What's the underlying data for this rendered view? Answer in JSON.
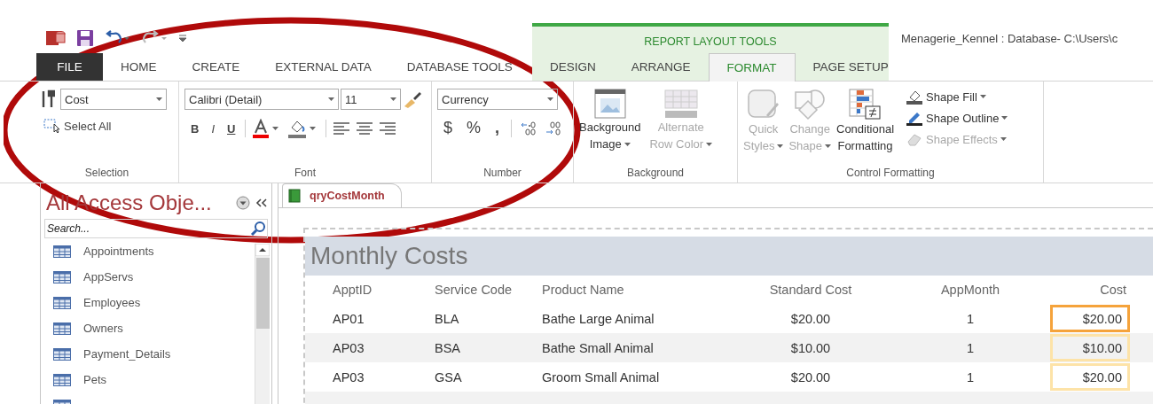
{
  "quick_access": {
    "undo_enabled": true,
    "redo_enabled": false
  },
  "context_label": "REPORT LAYOUT TOOLS",
  "window_title": "Menagerie_Kennel : Database- C:\\Users\\c",
  "tabs": [
    {
      "label": "FILE",
      "kind": "file",
      "selected": false
    },
    {
      "label": "HOME",
      "kind": "main",
      "selected": false
    },
    {
      "label": "CREATE",
      "kind": "main",
      "selected": false
    },
    {
      "label": "EXTERNAL DATA",
      "kind": "main",
      "selected": false
    },
    {
      "label": "DATABASE TOOLS",
      "kind": "main",
      "selected": false
    },
    {
      "label": "DESIGN",
      "kind": "context",
      "selected": false
    },
    {
      "label": "ARRANGE",
      "kind": "context",
      "selected": false
    },
    {
      "label": "FORMAT",
      "kind": "context",
      "selected": true
    },
    {
      "label": "PAGE SETUP",
      "kind": "context",
      "selected": false
    }
  ],
  "ribbon": {
    "selection": {
      "label": "Selection",
      "object": "Cost",
      "select_all": "Select All"
    },
    "font": {
      "label": "Font",
      "name": "Calibri (Detail)",
      "size": "11",
      "bold": "B",
      "italic": "I",
      "underline": "U"
    },
    "number": {
      "label": "Number",
      "format": "Currency",
      "currency": "$",
      "percent": "%",
      "comma": ","
    },
    "background": {
      "label": "Background",
      "buttons": [
        {
          "line1": "Background",
          "line2": "Image",
          "kind": "image",
          "disabled": false
        },
        {
          "line1": "Alternate",
          "line2": "Row Color",
          "kind": "rows",
          "disabled": true
        }
      ]
    },
    "control_formatting": {
      "label": "Control Formatting",
      "buttons": [
        {
          "line1": "Quick",
          "line2": "Styles",
          "kind": "styles",
          "disabled": true,
          "dropdown": true
        },
        {
          "line1": "Change",
          "line2": "Shape",
          "kind": "shape",
          "disabled": true,
          "dropdown": true
        },
        {
          "line1": "Conditional",
          "line2": "Formatting",
          "kind": "conditional",
          "disabled": false,
          "dropdown": false
        }
      ],
      "small": [
        {
          "label": "Shape Fill",
          "kind": "fill",
          "disabled": false
        },
        {
          "label": "Shape Outline",
          "kind": "outline",
          "disabled": false
        },
        {
          "label": "Shape Effects",
          "kind": "effects",
          "disabled": true
        }
      ]
    }
  },
  "nav": {
    "title": "All Access Obje...",
    "search": {
      "placeholder": "Search..."
    },
    "items": [
      "Appointments",
      "AppServs",
      "Employees",
      "Owners",
      "Payment_Details",
      "Pets"
    ]
  },
  "document": {
    "tab": "qryCostMonth",
    "report_title": "Monthly Costs",
    "columns": [
      "ApptID",
      "Service Code",
      "Product Name",
      "Standard Cost",
      "AppMonth",
      "Cost"
    ],
    "rows": [
      {
        "cells": [
          "AP01",
          "BLA",
          "Bathe Large Animal",
          "$20.00",
          "1",
          "$20.00"
        ],
        "cost_focused": true
      },
      {
        "cells": [
          "AP03",
          "BSA",
          "Bathe Small Animal",
          "$10.00",
          "1",
          "$10.00"
        ],
        "cost_focused": false
      },
      {
        "cells": [
          "AP03",
          "GSA",
          "Groom Small Animal",
          "$20.00",
          "1",
          "$20.00"
        ],
        "cost_focused": false
      }
    ]
  }
}
